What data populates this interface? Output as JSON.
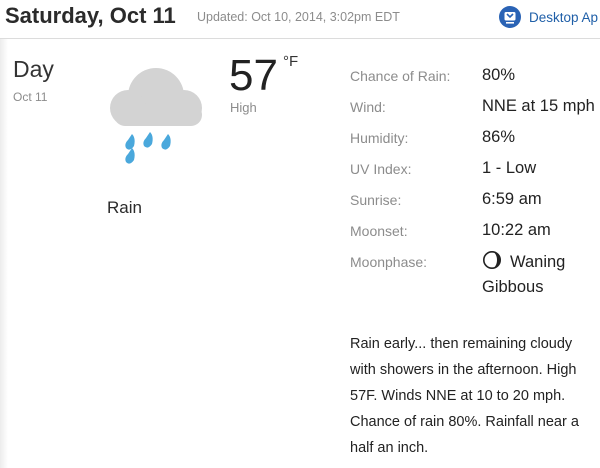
{
  "header": {
    "title": "Saturday, Oct 11",
    "updated": "Updated: Oct 10, 2014, 3:02pm EDT",
    "desktop_link": "Desktop Ap",
    "desktop_icon": "desktop-app-icon"
  },
  "forecast": {
    "period": "Day",
    "date": "Oct 11",
    "condition": "Rain",
    "icon": "rain-cloud-icon",
    "temperature": "57",
    "unit": "°F",
    "temp_label": "High"
  },
  "details": [
    {
      "label": "Chance of Rain:",
      "value": "80%"
    },
    {
      "label": "Wind:",
      "value": "NNE at 15 mph"
    },
    {
      "label": "Humidity:",
      "value": "86%"
    },
    {
      "label": "UV Index:",
      "value": "1 - Low"
    },
    {
      "label": "Sunrise:",
      "value": "6:59 am"
    },
    {
      "label": "Moonset:",
      "value": "10:22 am"
    }
  ],
  "moonphase": {
    "label": "Moonphase:",
    "value": "Waning Gibbous",
    "icon": "waning-gibbous-moon-icon"
  },
  "description": "Rain early... then remaining cloudy with showers in the afternoon. High 57F. Winds NNE at 10 to 20 mph. Chance of rain 80%. Rainfall near a half an inch.",
  "colors": {
    "link": "#1f5fa8",
    "muted_text": "#8c8c8c",
    "cloud": "#d3d3d3",
    "rain": "#4aa8dc"
  }
}
